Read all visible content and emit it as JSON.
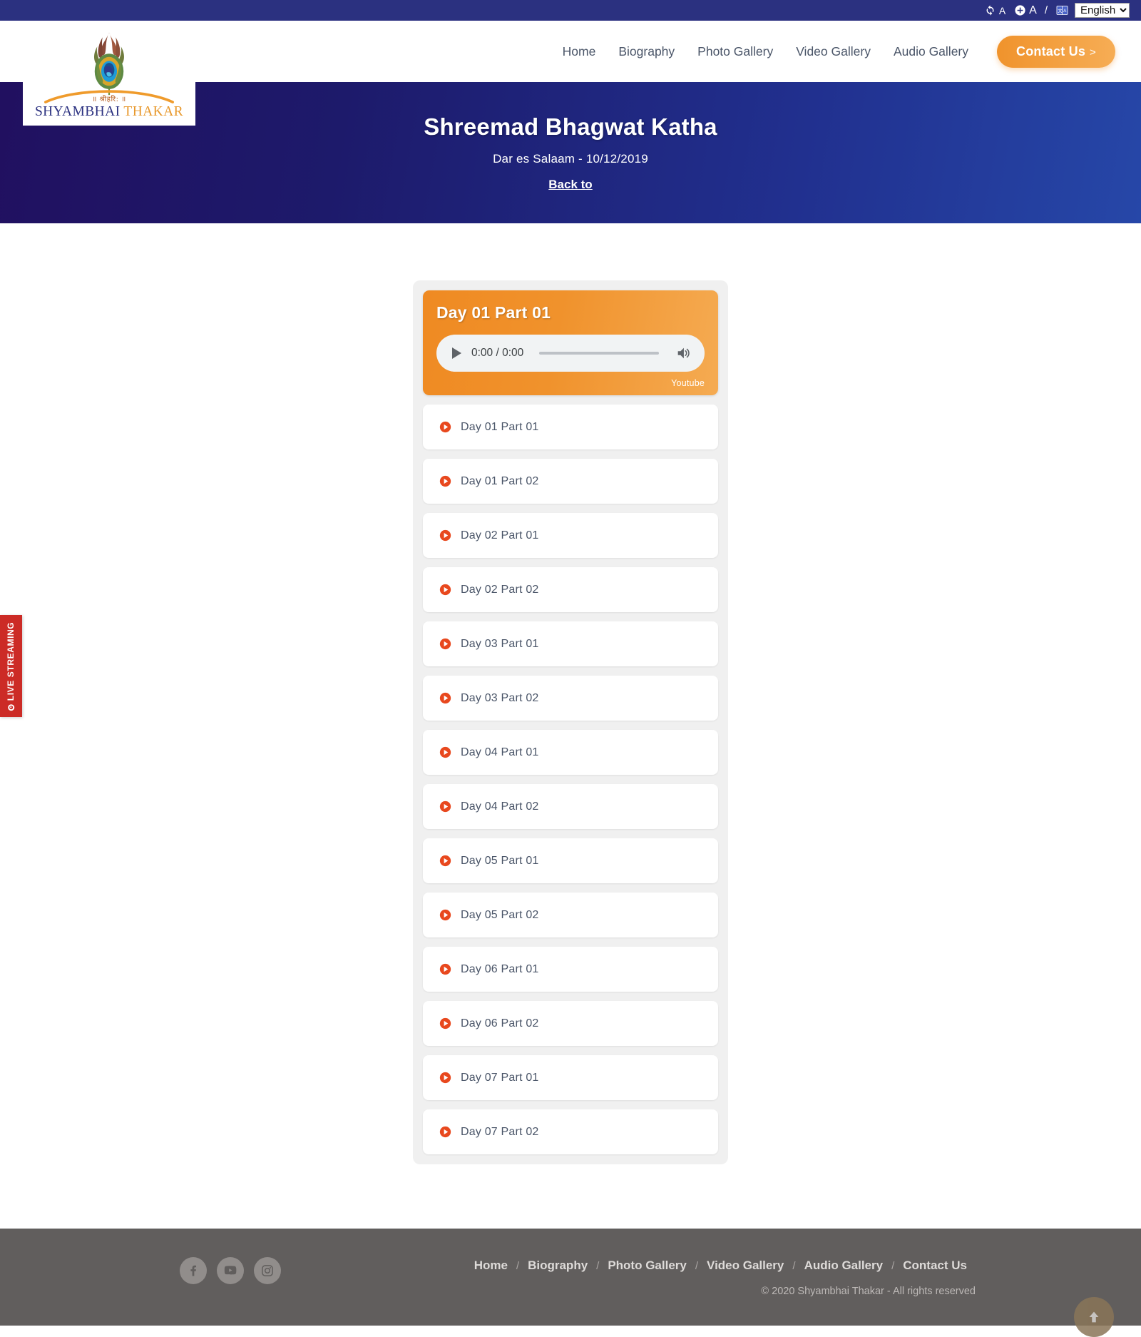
{
  "topbar": {
    "reset_font_icon": "refresh-icon",
    "reset_font_letter": "A",
    "increase_font_icon": "plus-circle-icon",
    "increase_font_letter": "A",
    "separator": "/",
    "translate_icon": "translate-icon",
    "language_selected": "English",
    "language_options": [
      "English"
    ]
  },
  "logo": {
    "sanskrit": "॥ श्रीहरि: ॥",
    "name_first": "SHYAMBHAI ",
    "name_second": "THAKAR"
  },
  "nav": {
    "items": [
      {
        "label": "Home"
      },
      {
        "label": "Biography"
      },
      {
        "label": "Photo Gallery"
      },
      {
        "label": "Video Gallery"
      },
      {
        "label": "Audio Gallery"
      }
    ],
    "cta_label": "Contact Us",
    "cta_chevron": ">"
  },
  "hero": {
    "title": "Shreemad Bhagwat Katha",
    "subtitle": "Dar es Salaam - 10/12/2019",
    "back_link": "Back to"
  },
  "player": {
    "title": "Day 01 Part 01",
    "current_time": "0:00",
    "duration": "0:00",
    "time_display": "0:00 / 0:00",
    "source_label": "Youtube",
    "play_icon": "play-icon",
    "volume_icon": "volume-icon",
    "progress_percent": 0
  },
  "tracks": [
    {
      "label": "Day 01 Part 01"
    },
    {
      "label": "Day 01 Part 02"
    },
    {
      "label": "Day 02 Part 01"
    },
    {
      "label": "Day 02 Part 02"
    },
    {
      "label": "Day 03 Part 01"
    },
    {
      "label": "Day 03 Part 02"
    },
    {
      "label": "Day 04 Part 01"
    },
    {
      "label": "Day 04 Part 02"
    },
    {
      "label": "Day 05 Part 01"
    },
    {
      "label": "Day 05 Part 02"
    },
    {
      "label": "Day 06 Part 01"
    },
    {
      "label": "Day 06 Part 02"
    },
    {
      "label": "Day 07 Part 01"
    },
    {
      "label": "Day 07 Part 02"
    }
  ],
  "live_tab": {
    "label": "LIVE STREAMING",
    "icon": "record-circle-icon"
  },
  "footer": {
    "socials": [
      {
        "name": "facebook-icon"
      },
      {
        "name": "youtube-icon"
      },
      {
        "name": "instagram-icon"
      }
    ],
    "links": [
      {
        "label": "Home"
      },
      {
        "label": "Biography"
      },
      {
        "label": "Photo Gallery"
      },
      {
        "label": "Video Gallery"
      },
      {
        "label": "Audio Gallery"
      },
      {
        "label": "Contact Us"
      }
    ],
    "separator": "/",
    "copyright": "© 2020 Shyambhai Thakar - All rights reserved",
    "to_top_icon": "arrow-up-icon"
  },
  "colors": {
    "topbar_blue": "#2b3180",
    "hero_gradient_start": "#211060",
    "hero_gradient_end": "#2647a8",
    "accent_orange": "#f0932c",
    "play_red": "#e8481e",
    "live_red": "#cc2b26",
    "footer_gray": "#615e5d"
  }
}
